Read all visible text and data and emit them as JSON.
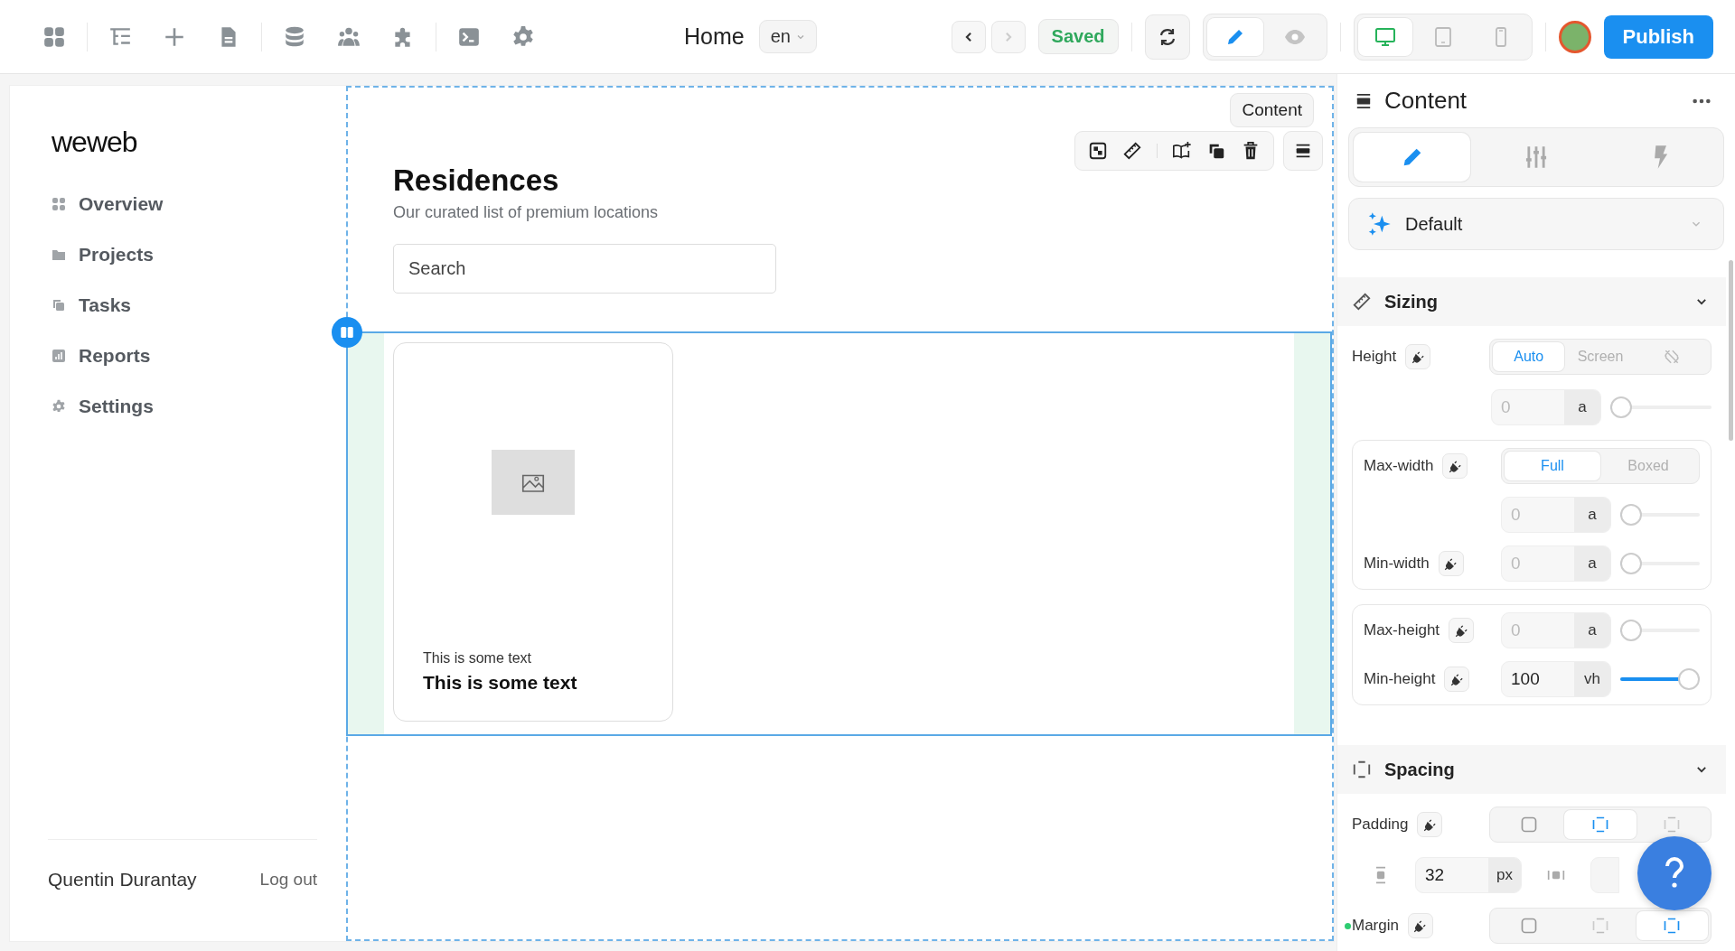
{
  "toolbar": {
    "page_title": "Home",
    "language": "en",
    "back_disabled": false,
    "forward_disabled": true,
    "save_status": "Saved",
    "modes": [
      {
        "kind": "edit",
        "selected": true
      },
      {
        "kind": "preview",
        "selected": false
      }
    ],
    "devices": [
      {
        "kind": "desktop",
        "selected": true
      },
      {
        "kind": "tablet",
        "selected": false
      },
      {
        "kind": "mobile",
        "selected": false
      }
    ],
    "publish": "Publish"
  },
  "app_sidebar": {
    "logo": "weweb",
    "nav": [
      {
        "label": "Overview",
        "kind": "grid"
      },
      {
        "label": "Projects",
        "kind": "folder"
      },
      {
        "label": "Tasks",
        "kind": "copy"
      },
      {
        "label": "Reports",
        "kind": "chart"
      },
      {
        "label": "Settings",
        "kind": "gear"
      }
    ],
    "user": "Quentin Durantay",
    "logout": "Log out"
  },
  "canvas": {
    "selection_label": "Content",
    "heading": "Residences",
    "subheading": "Our curated list of premium locations",
    "search": {
      "placeholder": "Search"
    },
    "cards": [
      {
        "caption": "This is some text",
        "title": "This is some text"
      }
    ]
  },
  "panel": {
    "title": "Content",
    "tabs": [
      {
        "kind": "edit",
        "selected": true
      },
      {
        "kind": "sliders",
        "selected": false
      },
      {
        "kind": "bolt",
        "selected": false
      }
    ],
    "preset": "Default",
    "sections": [
      {
        "title": "Sizing",
        "kind": "ruler",
        "expanded": true,
        "rows": [
          {
            "kind": "segmented",
            "label": "Height",
            "options": [
              {
                "kind": "text",
                "label": "Auto",
                "selected": true
              },
              {
                "kind": "text",
                "label": "Screen",
                "selected": false
              },
              {
                "kind": "unlink",
                "selected": false
              }
            ]
          },
          {
            "kind": "number",
            "placeholder": "0",
            "unit": "a",
            "level": 0
          },
          {
            "kind": "group",
            "rows": [
              {
                "kind": "segmented",
                "label": "Max-width",
                "options": [
                  {
                    "kind": "text",
                    "label": "Full",
                    "selected": true
                  },
                  {
                    "kind": "text",
                    "label": "Boxed",
                    "selected": false
                  }
                ]
              },
              {
                "kind": "number",
                "placeholder": "0",
                "unit": "a",
                "level": 0
              },
              {
                "kind": "number",
                "label": "Min-width",
                "placeholder": "0",
                "unit": "a",
                "level": 0
              }
            ]
          },
          {
            "kind": "group",
            "rows": [
              {
                "kind": "number",
                "label": "Max-height",
                "placeholder": "0",
                "unit": "a",
                "level": 0
              },
              {
                "kind": "number",
                "label": "Min-height",
                "value": "100",
                "unit": "vh",
                "level": 1
              }
            ]
          }
        ]
      },
      {
        "title": "Spacing",
        "kind": "box",
        "expanded": true,
        "rows": [
          {
            "kind": "segmented",
            "label": "Padding",
            "options": [
              {
                "kind": "all",
                "selected": false
              },
              {
                "kind": "vertical",
                "selected": true
              },
              {
                "kind": "horizontal",
                "selected": false
              }
            ]
          },
          {
            "kind": "pair",
            "value": "32",
            "unit": "px"
          },
          {
            "kind": "segmented",
            "label": "Margin",
            "color": "#2ecc71",
            "options": [
              {
                "kind": "all",
                "selected": false
              },
              {
                "kind": "horizontal",
                "selected": false
              },
              {
                "kind": "vertical",
                "selected": true
              }
            ]
          }
        ]
      }
    ]
  }
}
